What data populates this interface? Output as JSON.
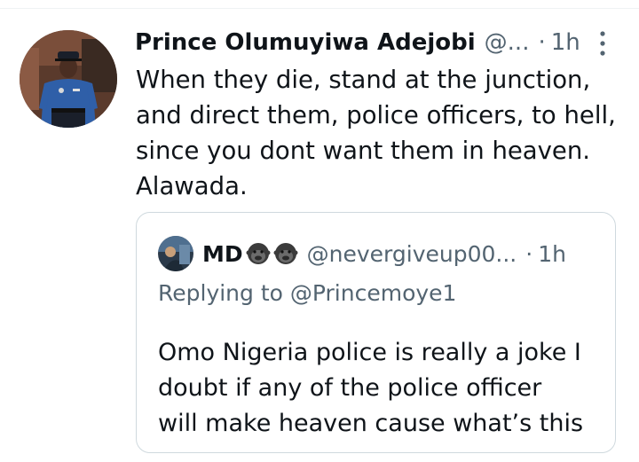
{
  "tweet": {
    "display_name": "Prince Olumuyiwa Adejobi",
    "handle": "@...",
    "separator": "·",
    "time": "1h",
    "text_lines": [
      "When they die, stand at the junction,",
      "and direct them, police officers, to hell,",
      "since you dont want them in heaven.",
      "Alawada."
    ],
    "avatar_icon": "police-officer-avatar",
    "more_icon": "vertical-ellipsis-icon"
  },
  "quoted_tweet": {
    "display_name": "MD",
    "name_emoji": [
      "gorilla-emoji",
      "gorilla-emoji"
    ],
    "handle": "@nevergiveup00...",
    "separator": "·",
    "time": "1h",
    "replying_to": "Replying to @Princemoye1",
    "text_lines": [
      "Omo Nigeria police is really a joke I",
      "doubt if any of the police officer",
      "will make heaven cause what’s this"
    ]
  },
  "colors": {
    "primary_text": "#0f1419",
    "secondary_text": "#536471",
    "border": "#cfd9de",
    "background": "#ffffff"
  }
}
